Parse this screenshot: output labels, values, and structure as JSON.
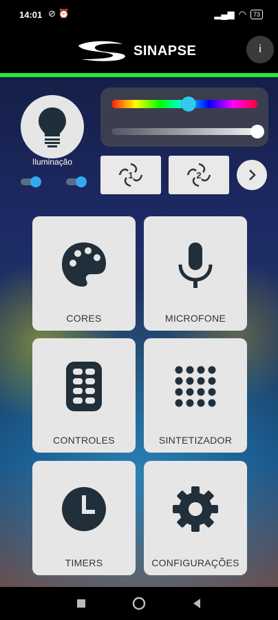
{
  "status_bar": {
    "time": "14:01",
    "battery": "73"
  },
  "header": {
    "app_name": "SINAPSE",
    "info_label": "i"
  },
  "lighting": {
    "label": "Iluminação",
    "toggle1_on": true,
    "toggle2_on": true
  },
  "color": {
    "hue_position": 0.53,
    "brightness": 1.0
  },
  "tiles": [
    {
      "label": "CORES",
      "icon": "palette-icon"
    },
    {
      "label": "MICROFONE",
      "icon": "microphone-icon"
    },
    {
      "label": "CONTROLES",
      "icon": "remote-control-icon"
    },
    {
      "label": "SINTETIZADOR",
      "icon": "dot-grid-icon"
    },
    {
      "label": "TIMERS",
      "icon": "clock-icon"
    },
    {
      "label": "CONFIGURAÇÕES",
      "icon": "gear-icon"
    }
  ],
  "scenes": [
    {
      "icon": "scene-1-icon"
    },
    {
      "icon": "scene-2-icon"
    }
  ]
}
